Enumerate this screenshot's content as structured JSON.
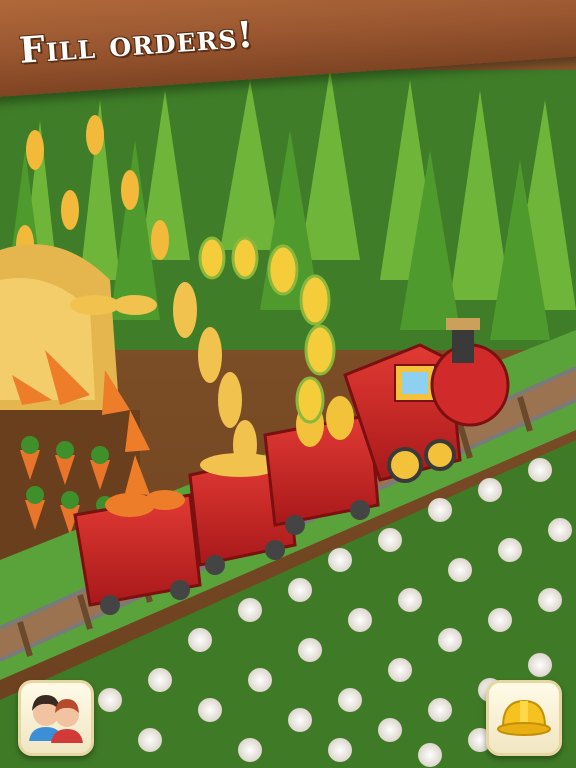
{
  "banner": {
    "title": "Fill orders!"
  },
  "buttons": {
    "friends": {
      "icon": "friends-icon"
    },
    "build": {
      "icon": "hard-hat-icon"
    }
  },
  "colors": {
    "banner_wood": "#9a5730",
    "train_red": "#d12a2a",
    "grass": "#4a8a2e",
    "soil": "#7a4a26"
  }
}
